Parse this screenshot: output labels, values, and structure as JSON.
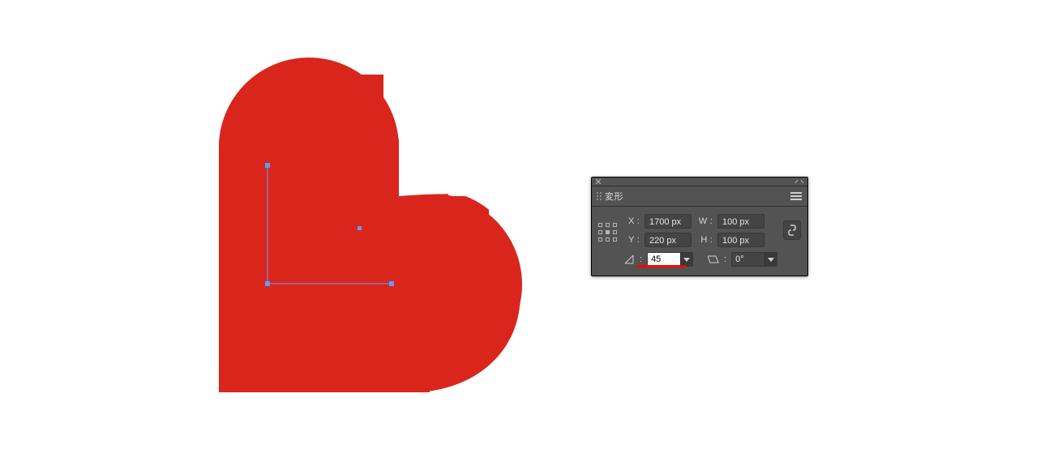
{
  "canvas": {
    "heart_fill": "#da251c",
    "selection_color": "#5e9cff"
  },
  "panel": {
    "title": "変形",
    "x_label": "X :",
    "y_label": "Y :",
    "w_label": "W :",
    "h_label": "H :",
    "x_value": "1700 px",
    "y_value": "220 px",
    "w_value": "100 px",
    "h_value": "100 px",
    "rotate_label": ":",
    "rotate_value": "45",
    "shear_label": ":",
    "shear_value": "0°",
    "reference_point": "center"
  }
}
